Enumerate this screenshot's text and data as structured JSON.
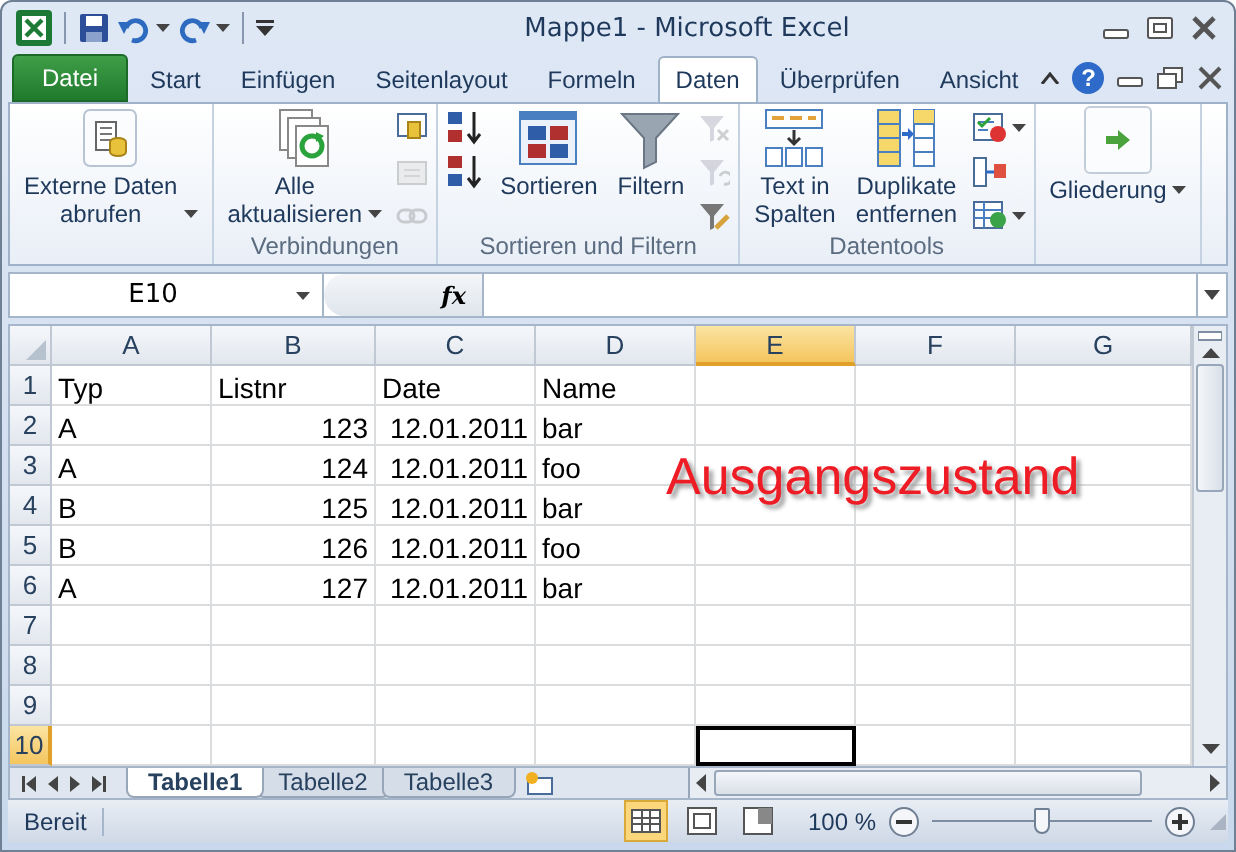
{
  "window": {
    "title": "Mappe1  -  Microsoft Excel"
  },
  "quick_access": [
    {
      "kind": "save",
      "dropdown": false
    },
    {
      "kind": "undo",
      "dropdown": true
    },
    {
      "kind": "redo",
      "dropdown": true
    },
    {
      "kind": "customize",
      "dropdown": false
    }
  ],
  "file_tab": "Datei",
  "tabs": [
    {
      "label": "Start",
      "selected": false
    },
    {
      "label": "Einfügen",
      "selected": false
    },
    {
      "label": "Seitenlayout",
      "selected": false
    },
    {
      "label": "Formeln",
      "selected": false
    },
    {
      "label": "Daten",
      "selected": true
    },
    {
      "label": "Überprüfen",
      "selected": false
    },
    {
      "label": "Ansicht",
      "selected": false
    }
  ],
  "help": "?",
  "ribbon": {
    "groups": [
      {
        "items": [
          {
            "kind": "large",
            "label": "Externe Daten\nabrufen",
            "dropdown": true
          }
        ]
      },
      {
        "label": "Verbindungen",
        "items": [
          {
            "kind": "large",
            "label": "Alle\naktualisieren",
            "dropdown": true
          },
          {
            "kind": "stack",
            "tools": [
              {
                "disabled": false,
                "dropdown": false
              },
              {
                "disabled": true,
                "dropdown": false
              },
              {
                "disabled": true,
                "dropdown": false
              }
            ]
          }
        ]
      },
      {
        "label": "Sortieren und Filtern",
        "items": [
          {
            "kind": "stack",
            "tools": [
              {
                "disabled": false,
                "dropdown": false
              },
              {
                "disabled": false,
                "dropdown": false
              }
            ]
          },
          {
            "kind": "large",
            "label": "Sortieren",
            "dropdown": false
          },
          {
            "kind": "large",
            "label": "Filtern",
            "dropdown": false
          },
          {
            "kind": "stack",
            "tools": [
              {
                "disabled": true,
                "dropdown": false
              },
              {
                "disabled": true,
                "dropdown": false
              },
              {
                "disabled": false,
                "dropdown": false
              }
            ]
          }
        ]
      },
      {
        "label": "Datentools",
        "items": [
          {
            "kind": "large",
            "label": "Text in\nSpalten",
            "dropdown": false
          },
          {
            "kind": "large",
            "label": "Duplikate\nentfernen",
            "dropdown": false
          },
          {
            "kind": "stack",
            "tools": [
              {
                "disabled": false,
                "dropdown": true
              },
              {
                "disabled": false,
                "dropdown": false
              },
              {
                "disabled": false,
                "dropdown": true
              }
            ]
          }
        ]
      },
      {
        "items": [
          {
            "kind": "large",
            "label": "Gliederung",
            "dropdown": true
          }
        ]
      }
    ]
  },
  "formula_bar": {
    "name_box": "E10",
    "function_symbol": "fx"
  },
  "sheet": {
    "columns": [
      {
        "label": "A",
        "selected": false
      },
      {
        "label": "B",
        "selected": false
      },
      {
        "label": "C",
        "selected": false
      },
      {
        "label": "D",
        "selected": false
      },
      {
        "label": "E",
        "selected": true
      },
      {
        "label": "F",
        "selected": false
      },
      {
        "label": "G",
        "selected": false
      }
    ],
    "rows": [
      {
        "number": "1",
        "selected": false,
        "cells": [
          {
            "text": "Typ",
            "kind": "text"
          },
          {
            "text": "Listnr",
            "kind": "text"
          },
          {
            "text": "Date",
            "kind": "text"
          },
          {
            "text": "Name",
            "kind": "text"
          }
        ]
      },
      {
        "number": "2",
        "selected": false,
        "cells": [
          {
            "text": "A",
            "kind": "text"
          },
          {
            "text": "123",
            "kind": "number"
          },
          {
            "text": "12.01.2011",
            "kind": "number"
          },
          {
            "text": "bar",
            "kind": "text"
          }
        ]
      },
      {
        "number": "3",
        "selected": false,
        "cells": [
          {
            "text": "A",
            "kind": "text"
          },
          {
            "text": "124",
            "kind": "number"
          },
          {
            "text": "12.01.2011",
            "kind": "number"
          },
          {
            "text": "foo",
            "kind": "text"
          }
        ]
      },
      {
        "number": "4",
        "selected": false,
        "cells": [
          {
            "text": "B",
            "kind": "text"
          },
          {
            "text": "125",
            "kind": "number"
          },
          {
            "text": "12.01.2011",
            "kind": "number"
          },
          {
            "text": "bar",
            "kind": "text"
          }
        ]
      },
      {
        "number": "5",
        "selected": false,
        "cells": [
          {
            "text": "B",
            "kind": "text"
          },
          {
            "text": "126",
            "kind": "number"
          },
          {
            "text": "12.01.2011",
            "kind": "number"
          },
          {
            "text": "foo",
            "kind": "text"
          }
        ]
      },
      {
        "number": "6",
        "selected": false,
        "cells": [
          {
            "text": "A",
            "kind": "text"
          },
          {
            "text": "127",
            "kind": "number"
          },
          {
            "text": "12.01.2011",
            "kind": "number"
          },
          {
            "text": "bar",
            "kind": "text"
          }
        ]
      },
      {
        "number": "7",
        "selected": false,
        "cells": []
      },
      {
        "number": "8",
        "selected": false,
        "cells": []
      },
      {
        "number": "9",
        "selected": false,
        "cells": []
      },
      {
        "number": "10",
        "selected": true,
        "cells": []
      }
    ],
    "annotation": "Ausgangszustand"
  },
  "sheet_tabs": [
    {
      "label": "Tabelle1",
      "selected": true
    },
    {
      "label": "Tabelle2",
      "selected": false
    },
    {
      "label": "Tabelle3",
      "selected": false
    }
  ],
  "status_bar": {
    "status": "Bereit",
    "views": [
      {
        "selected": true
      },
      {
        "selected": false
      },
      {
        "selected": false
      }
    ],
    "zoom": {
      "reading": "100 %",
      "level": 0.5
    }
  }
}
